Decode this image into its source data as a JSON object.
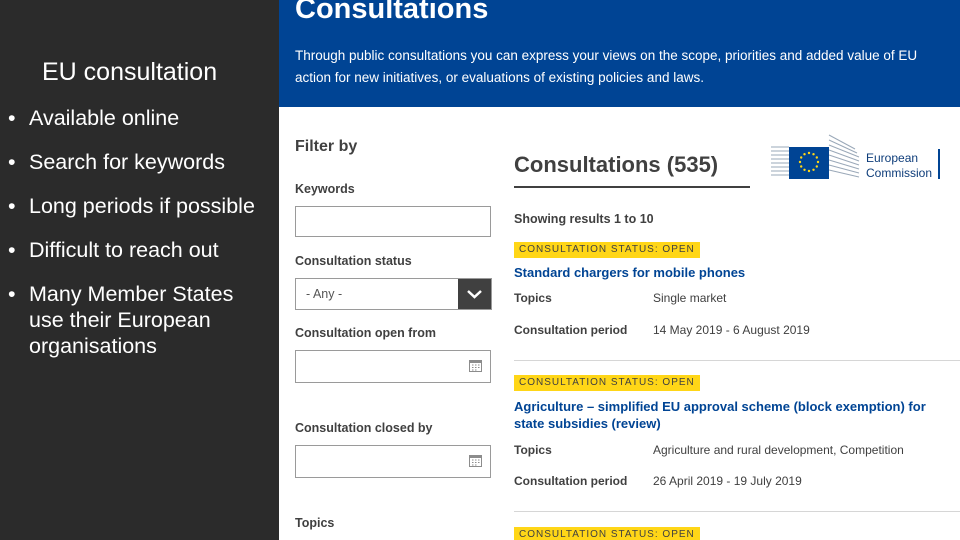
{
  "slide": {
    "title": "EU consultation",
    "bullets": [
      "Available online",
      "Search for keywords",
      "Long periods if possible",
      "Difficult to reach out",
      "Many Member States use their European organisations"
    ]
  },
  "site": {
    "header_title": "Consultations",
    "header_text": "Through public consultations you can express your views on the scope, priorities and added value of EU action for new initiatives, or evaluations of existing policies and laws.",
    "logo_text": [
      "European",
      "Commission"
    ],
    "colors": {
      "brand_blue": "#004494",
      "badge_yellow": "#ffd617",
      "text_dark": "#404040"
    }
  },
  "filter": {
    "title": "Filter by",
    "keywords_label": "Keywords",
    "keywords_value": "",
    "status_label": "Consultation status",
    "status_value": "- Any -",
    "open_from_label": "Consultation open from",
    "open_from_value": "",
    "closed_by_label": "Consultation closed by",
    "closed_by_value": "",
    "topics_label": "Topics"
  },
  "results": {
    "title": "Consultations (535)",
    "showing": "Showing results 1 to 10",
    "topics_label": "Topics",
    "period_label": "Consultation period",
    "items": [
      {
        "status": "CONSULTATION STATUS: OPEN",
        "title": "Standard chargers for mobile phones",
        "topics": "Single market",
        "period": "14 May 2019 - 6 August 2019"
      },
      {
        "status": "CONSULTATION STATUS: OPEN",
        "title": "Agriculture – simplified EU approval scheme (block exemption) for state subsidies (review)",
        "topics": "Agriculture and rural development, Competition",
        "period": "26 April 2019 - 19 July 2019"
      },
      {
        "status": "CONSULTATION STATUS: OPEN"
      }
    ]
  }
}
